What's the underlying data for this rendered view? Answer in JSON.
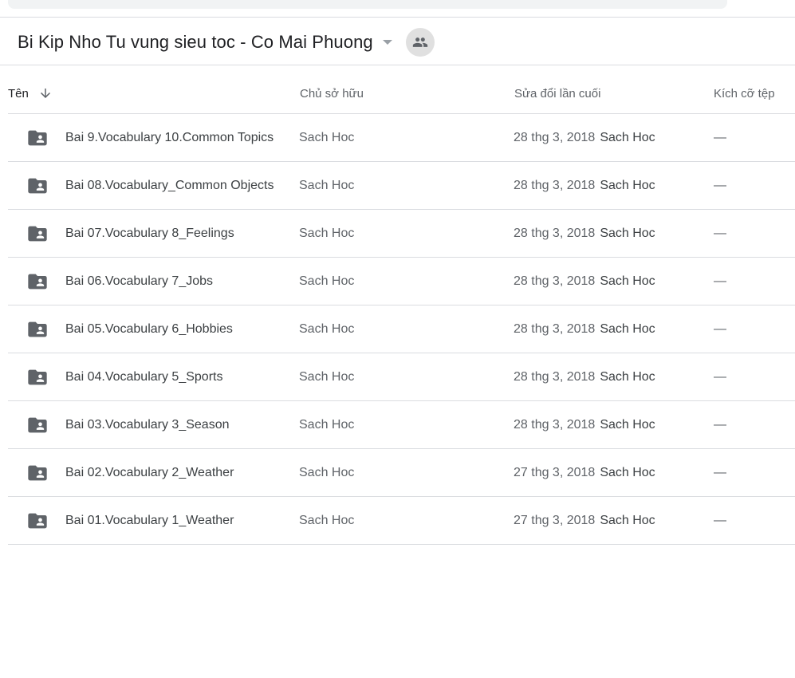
{
  "folder": {
    "title": "Bi Kip Nho Tu vung sieu toc - Co Mai Phuong",
    "caret_icon": "arrow-drop-down-icon",
    "share_icon": "people-icon"
  },
  "columns": {
    "name": "Tên",
    "owner": "Chủ sở hữu",
    "modified": "Sửa đổi lần cuối",
    "size": "Kích cỡ tệp",
    "sort_icon": "arrow-downward-icon"
  },
  "items": [
    {
      "name": "Bai 9.Vocabulary 10.Common Topics",
      "owner": "Sach Hoc",
      "modified_date": "28 thg 3, 2018",
      "modified_by": "Sach Hoc",
      "size": "—",
      "icon": "shared-folder-icon"
    },
    {
      "name": "Bai 08.Vocabulary_Common Objects",
      "owner": "Sach Hoc",
      "modified_date": "28 thg 3, 2018",
      "modified_by": "Sach Hoc",
      "size": "—",
      "icon": "shared-folder-icon"
    },
    {
      "name": "Bai 07.Vocabulary 8_Feelings",
      "owner": "Sach Hoc",
      "modified_date": "28 thg 3, 2018",
      "modified_by": "Sach Hoc",
      "size": "—",
      "icon": "shared-folder-icon"
    },
    {
      "name": "Bai 06.Vocabulary 7_Jobs",
      "owner": "Sach Hoc",
      "modified_date": "28 thg 3, 2018",
      "modified_by": "Sach Hoc",
      "size": "—",
      "icon": "shared-folder-icon"
    },
    {
      "name": "Bai 05.Vocabulary 6_Hobbies",
      "owner": "Sach Hoc",
      "modified_date": "28 thg 3, 2018",
      "modified_by": "Sach Hoc",
      "size": "—",
      "icon": "shared-folder-icon"
    },
    {
      "name": "Bai 04.Vocabulary 5_Sports",
      "owner": "Sach Hoc",
      "modified_date": "28 thg 3, 2018",
      "modified_by": "Sach Hoc",
      "size": "—",
      "icon": "shared-folder-icon"
    },
    {
      "name": "Bai 03.Vocabulary 3_Season",
      "owner": "Sach Hoc",
      "modified_date": "28 thg 3, 2018",
      "modified_by": "Sach Hoc",
      "size": "—",
      "icon": "shared-folder-icon"
    },
    {
      "name": "Bai 02.Vocabulary 2_Weather",
      "owner": "Sach Hoc",
      "modified_date": "27 thg 3, 2018",
      "modified_by": "Sach Hoc",
      "size": "—",
      "icon": "shared-folder-icon"
    },
    {
      "name": "Bai 01.Vocabulary 1_Weather",
      "owner": "Sach Hoc",
      "modified_date": "27 thg 3, 2018",
      "modified_by": "Sach Hoc",
      "size": "—",
      "icon": "shared-folder-icon"
    }
  ],
  "colors": {
    "divider": "#dadce0",
    "icon": "#5f6368",
    "text_primary": "#202124",
    "text_secondary": "#5f6368"
  }
}
